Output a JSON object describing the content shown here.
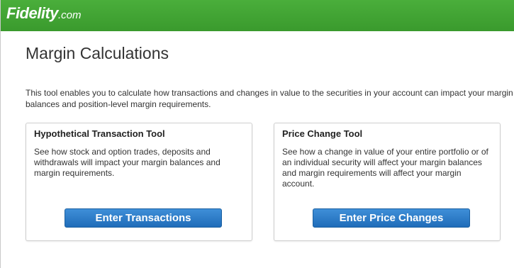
{
  "header": {
    "logo_text": "Fidelity",
    "logo_suffix": ".com",
    "brand_color": "#3fa632"
  },
  "main": {
    "title": "Margin Calculations",
    "intro": "This tool enables you to calculate how transactions and changes in value to the securities in your account can impact your margin balances and position-level margin requirements."
  },
  "cards": {
    "hypothetical": {
      "title": "Hypothetical Transaction Tool",
      "description": "See how stock and option trades, deposits and withdrawals will impact your margin balances and margin requirements.",
      "button_label": "Enter Transactions"
    },
    "price_change": {
      "title": "Price Change Tool",
      "description": "See how a change in value of your entire portfolio or of an individual security will affect your margin balances and margin requirements will affect your margin account.",
      "button_label": "Enter Price Changes"
    }
  },
  "colors": {
    "button_blue": "#2b7bc8"
  }
}
